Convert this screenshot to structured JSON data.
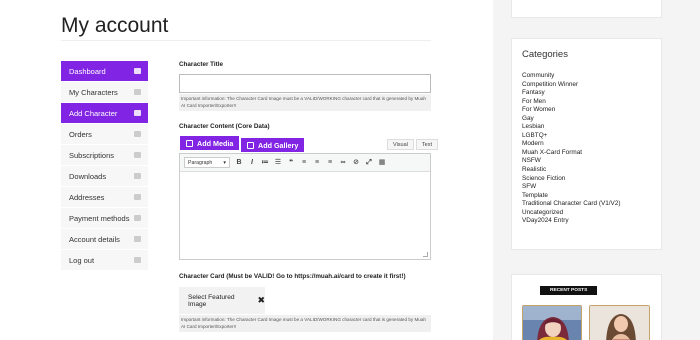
{
  "page": {
    "title": "My account"
  },
  "nav": [
    {
      "label": "Dashboard",
      "active": true,
      "icon": "dashboard-icon"
    },
    {
      "label": "My Characters",
      "active": false,
      "icon": "list-icon"
    },
    {
      "label": "Add Character",
      "active": true,
      "icon": "folder-icon"
    },
    {
      "label": "Orders",
      "active": false,
      "icon": "basket-icon"
    },
    {
      "label": "Subscriptions",
      "active": false,
      "icon": "file-icon"
    },
    {
      "label": "Downloads",
      "active": false,
      "icon": "cloud-download-icon"
    },
    {
      "label": "Addresses",
      "active": false,
      "icon": "home-icon"
    },
    {
      "label": "Payment methods",
      "active": false,
      "icon": "card-icon"
    },
    {
      "label": "Account details",
      "active": false,
      "icon": "user-icon"
    },
    {
      "label": "Log out",
      "active": false,
      "icon": "logout-icon"
    }
  ],
  "form": {
    "title_label": "Character Title",
    "title_value": "",
    "title_hint": "Important information: The Character Card Image must be a VALID/WORKING character card that is generated by Muah AI Card Importer/Exporter!!",
    "content_label": "Character Content (Core Data)",
    "add_media": "Add Media",
    "add_gallery": "Add Gallery",
    "tab_visual": "Visual",
    "tab_text": "Text",
    "paragraph_select": "Paragraph",
    "card_label": "Character Card (Must be VALID! Go to https://muah.ai/card to create it first!)",
    "featured_button": "Select Featured Image",
    "card_hint": "Important information: The Character Card Image must be a VALID/WORKING character card that is generated by Muah AI Card Importer/Exporter!!"
  },
  "sidebar": {
    "categories_title": "Categories",
    "categories": [
      "Community",
      "Competition Winner",
      "Fantasy",
      "For Men",
      "For Women",
      "Gay",
      "Lesbian",
      "LGBTQ+",
      "Modern",
      "Muah X-Card Format",
      "NSFW",
      "Realistic",
      "Science Fiction",
      "SFW",
      "Template",
      "Traditional Character Card (V1/V2)",
      "Uncategorized",
      "VDay2024 Entry"
    ],
    "recent_title": "RECENT POSTS"
  },
  "colors": {
    "accent": "#8224e3",
    "thumb_border": "#c4a36a"
  }
}
